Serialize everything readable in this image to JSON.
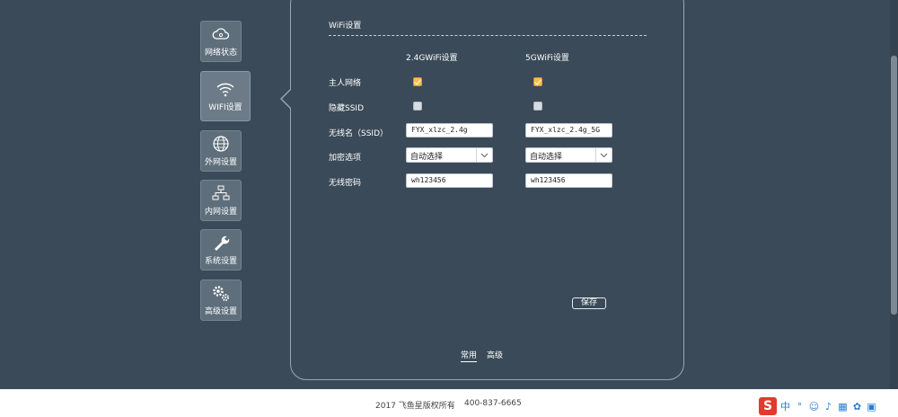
{
  "sidebar": {
    "items": [
      {
        "label": "网络状态",
        "icon": "cloud-icon"
      },
      {
        "label": "WIFI设置",
        "icon": "wifi-icon",
        "active": true
      },
      {
        "label": "外网设置",
        "icon": "globe-icon"
      },
      {
        "label": "内网设置",
        "icon": "network-topology-icon"
      },
      {
        "label": "系统设置",
        "icon": "wrench-icon"
      },
      {
        "label": "高级设置",
        "icon": "gears-icon"
      }
    ]
  },
  "wifi": {
    "section_title": "WiFi设置",
    "col_24g": "2.4GWiFi设置",
    "col_5g": "5GWiFi设置",
    "labels": {
      "main_network": "主人网络",
      "hide_ssid": "隐藏SSID",
      "ssid": "无线名（SSID）",
      "encryption": "加密选项",
      "password": "无线密码"
    },
    "g24": {
      "main_network_checked": true,
      "hide_ssid_checked": false,
      "ssid": "FYX_xlzc_2.4g",
      "encryption": "自动选择",
      "password": "wh123456"
    },
    "g5": {
      "main_network_checked": true,
      "hide_ssid_checked": false,
      "ssid": "FYX_xlzc_2.4g_5G",
      "encryption": "自动选择",
      "password": "wh123456"
    },
    "save_label": "保存"
  },
  "modes": {
    "normal": "常用",
    "advanced": "高级"
  },
  "footer": {
    "copyright": "2017 飞鱼星版权所有",
    "phone": "400-837-6665"
  },
  "colors": {
    "background": "#3a4a58",
    "checkbox_checked": "#f2c14e",
    "footer_bg": "#ffffff"
  }
}
